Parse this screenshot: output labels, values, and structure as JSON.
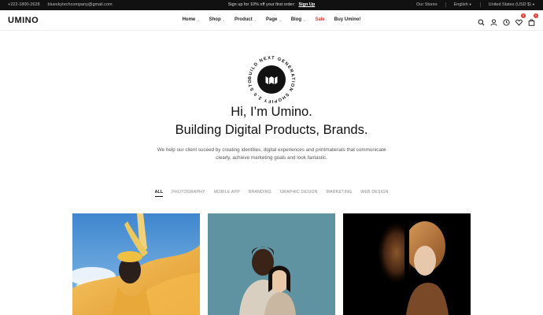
{
  "topbar": {
    "phone": "+222-1800-2628",
    "email": "blueskytechcompany@gmail.com",
    "promo": "Sign up for 10% off your first order:",
    "signup": "Sign Up",
    "stores": "Our Stores",
    "language": "English",
    "currency": "United States (USD $)"
  },
  "header": {
    "logo": "UMINO",
    "nav": [
      {
        "label": "Home"
      },
      {
        "label": "Shop"
      },
      {
        "label": "Product"
      },
      {
        "label": "Page"
      },
      {
        "label": "Blog"
      },
      {
        "label": "Sale"
      },
      {
        "label": "Buy Umino!"
      }
    ],
    "wishlist_count": "0",
    "cart_count": "0",
    "icons": [
      "search-icon",
      "user-icon",
      "history-icon",
      "heart-icon",
      "bag-icon"
    ]
  },
  "hero": {
    "stamp_text": "BUILD NEXT GENERATION SHOPIFY 2.0 STORE",
    "title_line1": "Hi, I’m Umino.",
    "title_line2": "Building Digital Products, Brands.",
    "description": "We help our client suceed by creating identities, digital experiences and printmaterials that communicate clearly, achieve marketing goals and look fantastic."
  },
  "filters": [
    {
      "label": "ALL",
      "active": true
    },
    {
      "label": "PHOTOGRAPHY"
    },
    {
      "label": "MOBILE APP"
    },
    {
      "label": "BRANDING"
    },
    {
      "label": "GRAPHIC DESIGN"
    },
    {
      "label": "MARKETING"
    },
    {
      "label": "WEB DESIGN"
    }
  ],
  "colors": {
    "accent_red": "#e53935",
    "topbar_bg": "#111111",
    "card2_bg": "#5f93a2",
    "card1_sky": "#4a8fd1"
  }
}
